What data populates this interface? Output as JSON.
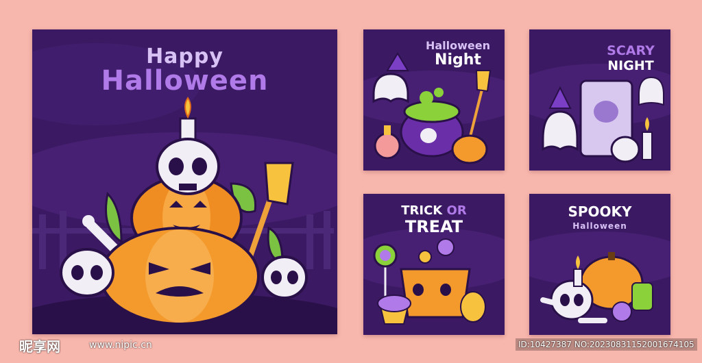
{
  "cards": {
    "main": {
      "line1": "Happy",
      "line2": "Halloween"
    },
    "halloween_night": {
      "line1": "Halloween",
      "line2": "Night"
    },
    "scary_night": {
      "line1": "SCARY",
      "line2": "NIGHT"
    },
    "trick_or_treat": {
      "line1a": "TRICK",
      "line1b": "OR",
      "line2": "TREAT"
    },
    "spooky": {
      "line1": "SPOOKY",
      "line2": "Halloween"
    }
  },
  "watermark": {
    "logo": "昵享网",
    "url": "www.nipic.cn",
    "id": "ID:10427387 NO:20230831152001674105"
  },
  "colors": {
    "background": "#f8b7ad",
    "card": "#3b1a63",
    "title_purple": "#b07be8",
    "title_light": "#d8c2f5",
    "pumpkin": "#f49a2c",
    "skull": "#f1eef6",
    "leaf": "#7cc242",
    "potion_green": "#8ad13a"
  },
  "icons": [
    "pumpkin-icon",
    "skull-icon",
    "candle-icon",
    "broom-icon",
    "ghost-icon",
    "tombstone-icon",
    "cauldron-icon",
    "candy-icon",
    "potion-icon"
  ]
}
